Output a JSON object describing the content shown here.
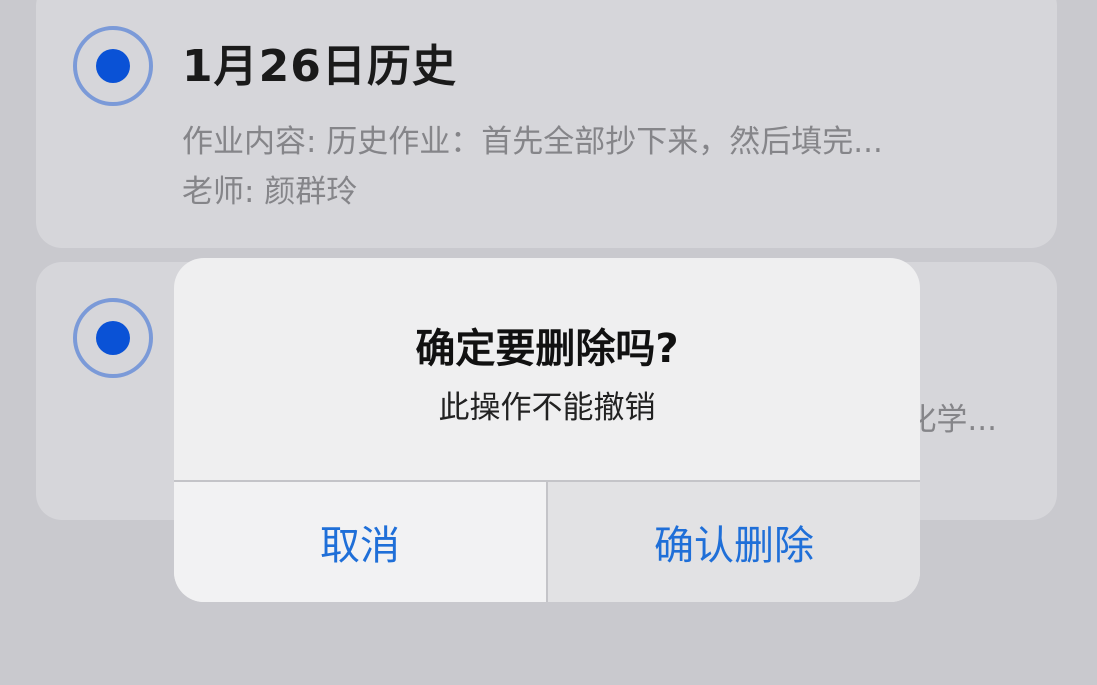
{
  "colors": {
    "background": "#c9c9ce",
    "card": "#d6d6da",
    "radio_ring": "#7b9ad8",
    "radio_dot": "#0a52d6",
    "action_blue": "#1f6fd8"
  },
  "list": {
    "items": [
      {
        "title": "1月26日历史",
        "content": "作业内容: 历史作业：首先全部抄下来，然后填完...",
        "teacher": "老师: 颜群玲",
        "selected": true
      },
      {
        "peek_text": "化学...",
        "selected": true
      }
    ]
  },
  "dialog": {
    "title": "确定要删除吗?",
    "message": "此操作不能撤销",
    "cancel_label": "取消",
    "confirm_label": "确认删除"
  }
}
